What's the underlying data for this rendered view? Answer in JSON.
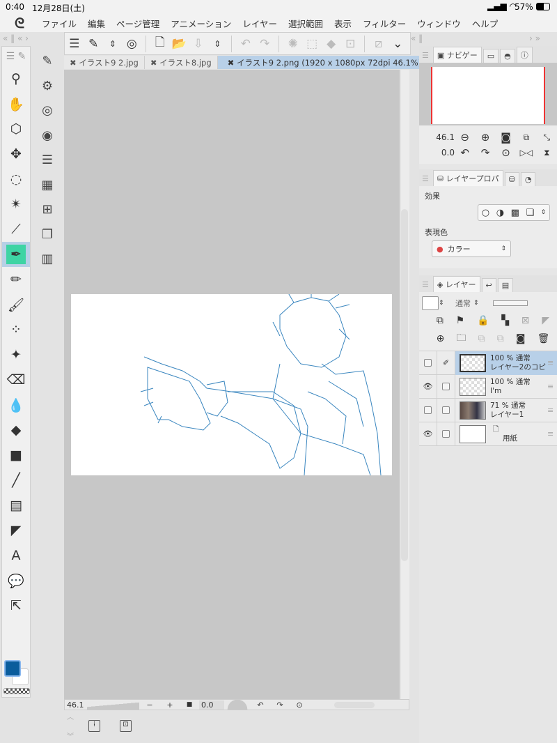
{
  "status": {
    "time": "0:40",
    "date": "12月28日(土)",
    "battery": "57%"
  },
  "menu": [
    "ファイル",
    "編集",
    "ページ管理",
    "アニメーション",
    "レイヤー",
    "選択範囲",
    "表示",
    "フィルター",
    "ウィンドウ",
    "ヘルプ"
  ],
  "tabs": [
    {
      "label": "イラスト9 2.jpg",
      "active": false
    },
    {
      "label": "イラスト8.jpg",
      "active": false
    },
    {
      "label": "イラスト9 2.png (1920 x 1080px 72dpi 46.1%)",
      "active": true
    }
  ],
  "navigator": {
    "tab": "ナビゲー",
    "zoom": "46.1",
    "rotation": "0.0"
  },
  "layer_property": {
    "tab": "レイヤープロパ",
    "effect_label": "効果",
    "expression_label": "表現色",
    "expression_value": "カラー"
  },
  "layers_panel": {
    "tab": "レイヤー",
    "blend_mode": "通常",
    "layers": [
      {
        "opacity": "100 %",
        "mode": "通常",
        "name": "レイヤー2のコピ",
        "selected": true,
        "visible": false
      },
      {
        "opacity": "100 %",
        "mode": "通常",
        "name": "I'm",
        "selected": false,
        "visible": true
      },
      {
        "opacity": "71 %",
        "mode": "通常",
        "name": "レイヤー1",
        "selected": false,
        "visible": false
      },
      {
        "opacity": "",
        "mode": "",
        "name": "用紙",
        "selected": false,
        "visible": true
      }
    ]
  },
  "bottom": {
    "zoom": "46.1",
    "rotation": "0.0",
    "minus": "−",
    "plus": "+"
  },
  "colors": {
    "main": "#0a5c9c",
    "sub": "#ffffff",
    "accent": "#b8d0e8",
    "line": "#3a86bf"
  }
}
